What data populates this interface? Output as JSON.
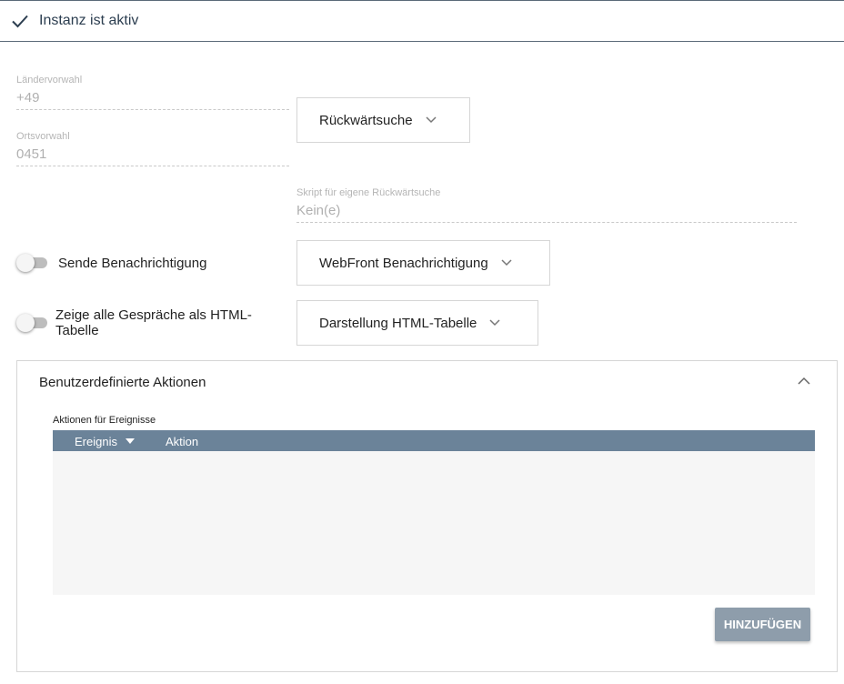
{
  "status": {
    "label": "Instanz ist aktiv",
    "icon": "check-icon"
  },
  "fields": {
    "country_code": {
      "label": "Ländervorwahl",
      "value": "+49"
    },
    "area_code": {
      "label": "Ortsvorwahl",
      "value": "0451"
    },
    "reverse_script": {
      "label": "Skript für eigene Rückwärtsuche",
      "value": "Kein(e)"
    }
  },
  "dropdowns": {
    "reverse_lookup": "Rückwärtsuche",
    "webfront_notification": "WebFront Benachrichtigung",
    "html_table_display": "Darstellung HTML-Tabelle"
  },
  "toggles": {
    "send_notification": {
      "label": "Sende Benachrichtigung",
      "on": false
    },
    "show_calls_html": {
      "label": "Zeige alle Gespräche als HTML-Tabelle",
      "on": false
    }
  },
  "custom_actions": {
    "title": "Benutzerdefinierte Aktionen",
    "table_label": "Aktionen für Ereignisse",
    "columns": [
      "Ereignis",
      "Aktion"
    ],
    "rows": [],
    "add_button": "HINZUFÜGEN"
  },
  "colors": {
    "table_header": "#6b8399",
    "button": "#8e9dab",
    "divider": "#5a6a78"
  }
}
